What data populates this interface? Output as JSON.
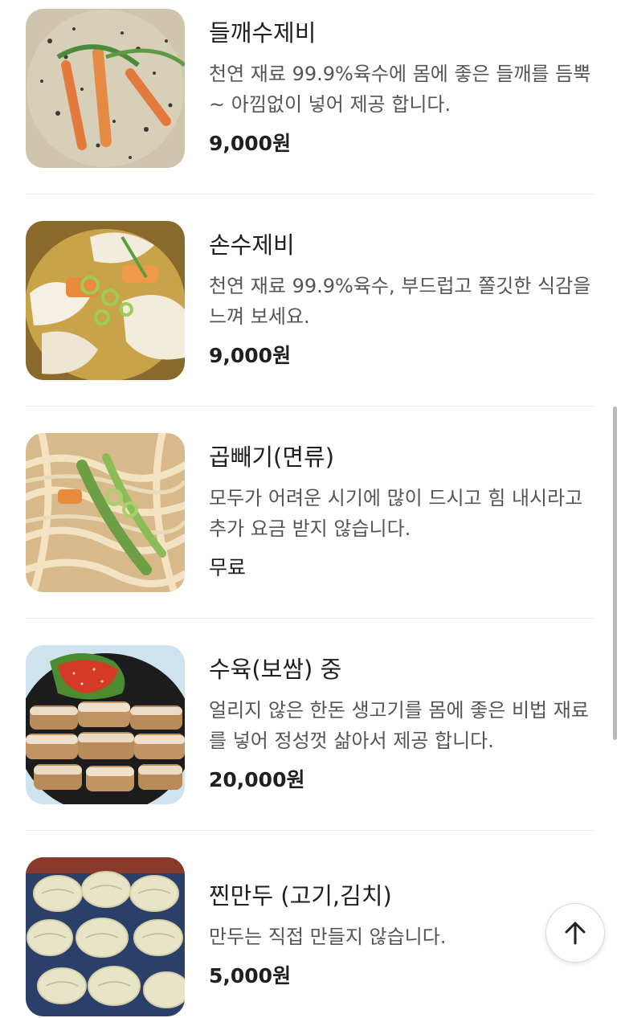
{
  "menu": {
    "items": [
      {
        "name": "들깨수제비",
        "description": "천연 재료 99.9%육수에 몸에 좋은 들깨를 듬뿍~ 아낌없이 넣어 제공 합니다.",
        "price": "9,000원",
        "image_icon": "perilla-sujebi-photo"
      },
      {
        "name": "손수제비",
        "description": "천연 재료 99.9%육수, 부드럽고 쫄깃한 식감을 느껴 보세요.",
        "price": "9,000원",
        "image_icon": "hand-sujebi-photo"
      },
      {
        "name": "곱빼기(면류)",
        "description": "모두가 어려운 시기에 많이 드시고 힘 내시라고 추가 요금 받지 않습니다.",
        "price": "무료",
        "image_icon": "noodle-bowl-photo"
      },
      {
        "name": "수육(보쌈) 중",
        "description": "얼리지 않은 한돈 생고기를 몸에 좋은 비법 재료를 넣어 정성껏 삶아서 제공 합니다.",
        "price": "20,000원",
        "image_icon": "bossam-photo"
      },
      {
        "name": "찐만두 (고기,김치)",
        "description": "만두는 직접 만들지 않습니다.",
        "price": "5,000원",
        "image_icon": "steamed-dumplings-photo"
      }
    ]
  },
  "controls": {
    "scroll_top_icon": "arrow-up-icon"
  },
  "colors": {
    "text_primary": "#1f1f1f",
    "text_secondary": "#555555",
    "divider": "#ececec"
  }
}
